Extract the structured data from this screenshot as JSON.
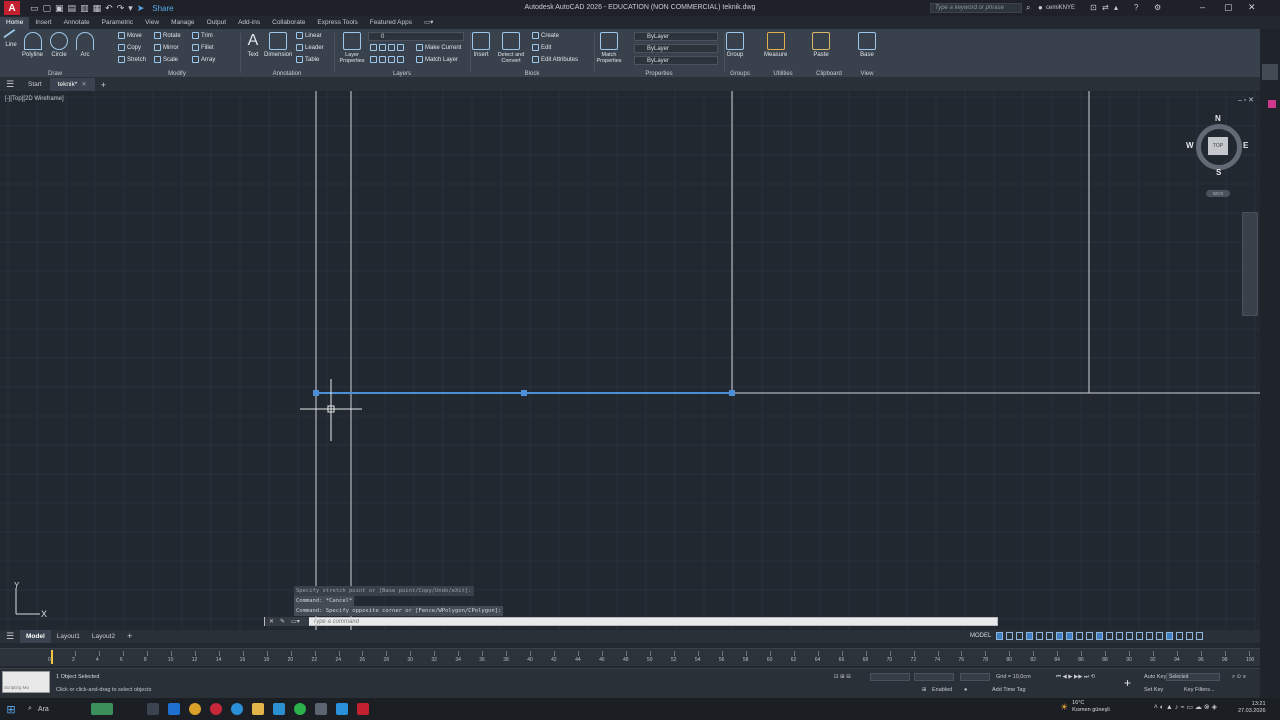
{
  "titlebar": {
    "logo": "A",
    "share_label": "Share",
    "title": "Autodesk AutoCAD 2026 - EDUCATION (NON COMMERCIAL)   teknik.dwg",
    "search_placeholder": "Type a keyword or phrase",
    "user": "cemiKNYE"
  },
  "ribbon_tabs": [
    "Home",
    "Insert",
    "Annotate",
    "Parametric",
    "View",
    "Manage",
    "Output",
    "Add-ins",
    "Collaborate",
    "Express Tools",
    "Featured Apps"
  ],
  "ribbon": {
    "draw": {
      "label": "Draw",
      "buttons": [
        "Line",
        "Polyline",
        "Circle",
        "Arc"
      ]
    },
    "modify": {
      "label": "Modify",
      "buttons": [
        "Move",
        "Rotate",
        "Trim",
        "Copy",
        "Mirror",
        "Fillet",
        "Stretch",
        "Scale",
        "Array"
      ]
    },
    "annotation": {
      "label": "Annotation",
      "buttons": [
        "Text",
        "Dimension",
        "Linear",
        "Leader",
        "Table"
      ]
    },
    "layers": {
      "label": "Layers",
      "layer_properties": "Layer Properties",
      "make_current": "Make Current",
      "match_layer": "Match Layer",
      "layer_value": "0"
    },
    "block": {
      "label": "Block",
      "insert": "Insert",
      "detect_convert": "Detect and Convert",
      "create": "Create",
      "edit": "Edit",
      "edit_attributes": "Edit Attributes"
    },
    "properties": {
      "label": "Properties",
      "match_properties": "Match Properties",
      "color": "ByLayer",
      "linetype": "ByLayer",
      "lineweight": "ByLayer"
    },
    "groups": {
      "label": "Groups",
      "group": "Group"
    },
    "utilities": {
      "label": "Utilities",
      "measure": "Measure"
    },
    "clipboard": {
      "label": "Clipboard",
      "paste": "Paste"
    },
    "view": {
      "label": "View",
      "base": "Base"
    }
  },
  "file_tabs": {
    "start": "Start",
    "active": "teknik*"
  },
  "viewport": {
    "label": "[-][Top][2D Wireframe]",
    "viewcube": {
      "top": "TOP",
      "n": "N",
      "s": "S",
      "e": "E",
      "w": "W",
      "wcs": "WCS"
    },
    "ucs": {
      "x": "X",
      "y": "Y"
    }
  },
  "command": {
    "history": [
      "Specify stretch point or [Base point/Copy/Undo/eXit]:",
      "Command: *Cancel*",
      "Command: Specify opposite corner or [Fence/WPolygon/CPolygon]:"
    ],
    "placeholder": "Type a command"
  },
  "layout_tabs": [
    "Model",
    "Layout1",
    "Layout2"
  ],
  "model_tag": "MODEL",
  "timeline_ticks": [
    "0",
    "2",
    "4",
    "6",
    "8",
    "10",
    "12",
    "14",
    "16",
    "18",
    "20",
    "22",
    "24",
    "26",
    "28",
    "30",
    "32",
    "34",
    "36",
    "38",
    "40",
    "42",
    "44",
    "46",
    "48",
    "50",
    "52",
    "54",
    "56",
    "58",
    "60",
    "62",
    "64",
    "66",
    "68",
    "70",
    "72",
    "74",
    "76",
    "78",
    "80",
    "82",
    "84",
    "86",
    "88",
    "90",
    "92",
    "94",
    "96",
    "98",
    "100"
  ],
  "status": {
    "thumb_label": "Scripting Mo",
    "selected_count": "1 Object Selected",
    "hint": "Click or click-and-drag to select objects",
    "enabled": "Enabled",
    "grid": "Grid = 10,0cm",
    "add_time_tag": "Add Time Tag",
    "auto_key": "Auto Key",
    "selected": "Selected",
    "set_key": "Set Key",
    "key_filters": "Key Filters..."
  },
  "taskbar": {
    "search": "Ara",
    "weather_temp": "16°C",
    "weather_text": "Kısmen güneşli",
    "time": "13:21",
    "date": "27.03.2026"
  }
}
